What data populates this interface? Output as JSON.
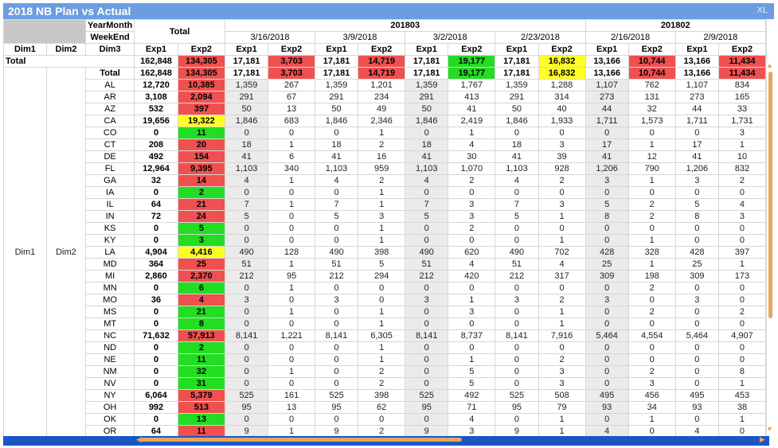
{
  "window": {
    "title": "2018 NB Plan vs Actual",
    "xl_label": "XL"
  },
  "header": {
    "yearmonth_label": "YearMonth",
    "weekend_label": "WeekEnd",
    "total_label": "Total",
    "months": [
      "201803",
      "201802"
    ],
    "week_dates": [
      "3/16/2018",
      "3/9/2018",
      "3/2/2018",
      "2/23/2018",
      "2/16/2018",
      "2/9/2018"
    ],
    "dim_labels": [
      "Dim1",
      "Dim2",
      "Dim3"
    ],
    "exp_labels": [
      "Exp1",
      "Exp2"
    ]
  },
  "grand_total": {
    "label": "Total",
    "values": [
      "162,848",
      "134,305",
      "17,181",
      "3,703",
      "17,181",
      "14,719",
      "17,181",
      "19,177",
      "17,181",
      "16,832",
      "13,166",
      "10,744",
      "13,166",
      "11,434"
    ]
  },
  "group": {
    "dim1": "Dim1",
    "dim2": "Dim2",
    "total_label": "Total",
    "total_values": [
      "162,848",
      "134,305",
      "17,181",
      "3,703",
      "17,181",
      "14,719",
      "17,181",
      "19,177",
      "17,181",
      "16,832",
      "13,166",
      "10,744",
      "13,166",
      "11,434"
    ]
  },
  "rows": [
    {
      "state": "AL",
      "values": [
        "12,720",
        "10,385",
        "1,359",
        "267",
        "1,359",
        "1,201",
        "1,359",
        "1,767",
        "1,359",
        "1,288",
        "1,107",
        "762",
        "1,107",
        "834"
      ]
    },
    {
      "state": "AR",
      "values": [
        "3,108",
        "2,094",
        "291",
        "67",
        "291",
        "234",
        "291",
        "413",
        "291",
        "314",
        "273",
        "131",
        "273",
        "165"
      ]
    },
    {
      "state": "AZ",
      "values": [
        "532",
        "397",
        "50",
        "13",
        "50",
        "49",
        "50",
        "41",
        "50",
        "40",
        "44",
        "32",
        "44",
        "33"
      ]
    },
    {
      "state": "CA",
      "values": [
        "19,656",
        "19,322",
        "1,846",
        "683",
        "1,846",
        "2,346",
        "1,846",
        "2,419",
        "1,846",
        "1,933",
        "1,711",
        "1,573",
        "1,711",
        "1,731"
      ]
    },
    {
      "state": "CO",
      "values": [
        "0",
        "11",
        "0",
        "0",
        "0",
        "1",
        "0",
        "1",
        "0",
        "0",
        "0",
        "0",
        "0",
        "3"
      ]
    },
    {
      "state": "CT",
      "values": [
        "208",
        "20",
        "18",
        "1",
        "18",
        "2",
        "18",
        "4",
        "18",
        "3",
        "17",
        "1",
        "17",
        "1"
      ]
    },
    {
      "state": "DE",
      "values": [
        "492",
        "154",
        "41",
        "6",
        "41",
        "16",
        "41",
        "30",
        "41",
        "39",
        "41",
        "12",
        "41",
        "10"
      ]
    },
    {
      "state": "FL",
      "values": [
        "12,964",
        "9,395",
        "1,103",
        "340",
        "1,103",
        "959",
        "1,103",
        "1,070",
        "1,103",
        "928",
        "1,206",
        "790",
        "1,206",
        "832"
      ]
    },
    {
      "state": "GA",
      "values": [
        "32",
        "14",
        "4",
        "1",
        "4",
        "2",
        "4",
        "2",
        "4",
        "2",
        "3",
        "1",
        "3",
        "2"
      ]
    },
    {
      "state": "IA",
      "values": [
        "0",
        "2",
        "0",
        "0",
        "0",
        "1",
        "0",
        "0",
        "0",
        "0",
        "0",
        "0",
        "0",
        "0"
      ]
    },
    {
      "state": "IL",
      "values": [
        "64",
        "21",
        "7",
        "1",
        "7",
        "1",
        "7",
        "3",
        "7",
        "3",
        "5",
        "2",
        "5",
        "4"
      ]
    },
    {
      "state": "IN",
      "values": [
        "72",
        "24",
        "5",
        "0",
        "5",
        "3",
        "5",
        "3",
        "5",
        "1",
        "8",
        "2",
        "8",
        "3"
      ]
    },
    {
      "state": "KS",
      "values": [
        "0",
        "5",
        "0",
        "0",
        "0",
        "1",
        "0",
        "2",
        "0",
        "0",
        "0",
        "0",
        "0",
        "0"
      ]
    },
    {
      "state": "KY",
      "values": [
        "0",
        "3",
        "0",
        "0",
        "0",
        "1",
        "0",
        "0",
        "0",
        "1",
        "0",
        "1",
        "0",
        "0"
      ]
    },
    {
      "state": "LA",
      "values": [
        "4,904",
        "4,416",
        "490",
        "128",
        "490",
        "398",
        "490",
        "620",
        "490",
        "702",
        "428",
        "328",
        "428",
        "397"
      ]
    },
    {
      "state": "MD",
      "values": [
        "364",
        "25",
        "51",
        "1",
        "51",
        "5",
        "51",
        "4",
        "51",
        "4",
        "25",
        "1",
        "25",
        "1"
      ]
    },
    {
      "state": "MI",
      "values": [
        "2,860",
        "2,370",
        "212",
        "95",
        "212",
        "294",
        "212",
        "420",
        "212",
        "317",
        "309",
        "198",
        "309",
        "173"
      ]
    },
    {
      "state": "MN",
      "values": [
        "0",
        "6",
        "0",
        "1",
        "0",
        "0",
        "0",
        "0",
        "0",
        "0",
        "0",
        "2",
        "0",
        "0"
      ]
    },
    {
      "state": "MO",
      "values": [
        "36",
        "4",
        "3",
        "0",
        "3",
        "0",
        "3",
        "1",
        "3",
        "2",
        "3",
        "0",
        "3",
        "0"
      ]
    },
    {
      "state": "MS",
      "values": [
        "0",
        "21",
        "0",
        "1",
        "0",
        "1",
        "0",
        "3",
        "0",
        "1",
        "0",
        "2",
        "0",
        "2"
      ]
    },
    {
      "state": "MT",
      "values": [
        "0",
        "8",
        "0",
        "0",
        "0",
        "1",
        "0",
        "0",
        "0",
        "1",
        "0",
        "0",
        "0",
        "0"
      ]
    },
    {
      "state": "NC",
      "values": [
        "71,632",
        "57,913",
        "8,141",
        "1,221",
        "8,141",
        "6,305",
        "8,141",
        "8,737",
        "8,141",
        "7,916",
        "5,464",
        "4,554",
        "5,464",
        "4,907"
      ]
    },
    {
      "state": "ND",
      "values": [
        "0",
        "2",
        "0",
        "0",
        "0",
        "1",
        "0",
        "0",
        "0",
        "0",
        "0",
        "0",
        "0",
        "0"
      ]
    },
    {
      "state": "NE",
      "values": [
        "0",
        "11",
        "0",
        "0",
        "0",
        "1",
        "0",
        "1",
        "0",
        "2",
        "0",
        "0",
        "0",
        "0"
      ]
    },
    {
      "state": "NM",
      "values": [
        "0",
        "32",
        "0",
        "1",
        "0",
        "2",
        "0",
        "5",
        "0",
        "3",
        "0",
        "2",
        "0",
        "8"
      ]
    },
    {
      "state": "NV",
      "values": [
        "0",
        "31",
        "0",
        "0",
        "0",
        "2",
        "0",
        "5",
        "0",
        "3",
        "0",
        "3",
        "0",
        "1"
      ]
    },
    {
      "state": "NY",
      "values": [
        "6,064",
        "5,379",
        "525",
        "161",
        "525",
        "398",
        "525",
        "492",
        "525",
        "508",
        "495",
        "456",
        "495",
        "453"
      ]
    },
    {
      "state": "OH",
      "values": [
        "992",
        "513",
        "95",
        "13",
        "95",
        "62",
        "95",
        "71",
        "95",
        "79",
        "93",
        "34",
        "93",
        "38"
      ]
    },
    {
      "state": "OK",
      "values": [
        "0",
        "13",
        "0",
        "0",
        "0",
        "0",
        "0",
        "4",
        "0",
        "1",
        "0",
        "1",
        "0",
        "1"
      ]
    },
    {
      "state": "OR",
      "values": [
        "64",
        "11",
        "9",
        "1",
        "9",
        "2",
        "9",
        "3",
        "9",
        "1",
        "4",
        "0",
        "4",
        "0"
      ]
    }
  ],
  "colors": {
    "title_bar": "#6b9de0",
    "red": "#f05050",
    "green": "#22dd22",
    "yellow": "#ffff22",
    "scroll": "#e8a55a",
    "bottom_strip": "#1a56c4"
  }
}
